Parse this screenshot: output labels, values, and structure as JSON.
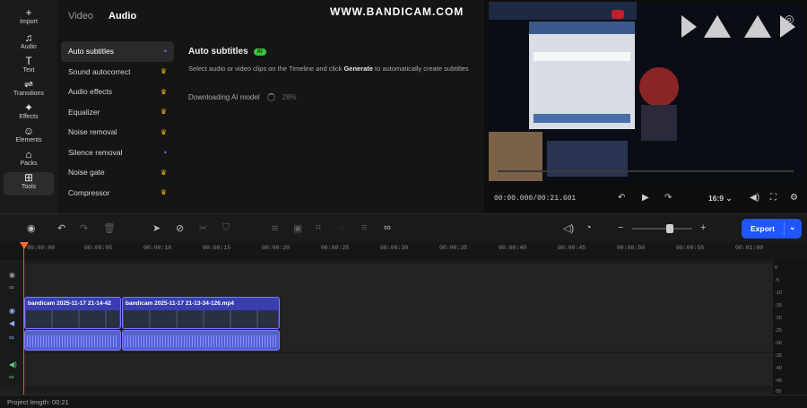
{
  "rail": [
    {
      "label": "Import",
      "icon": "plus-icon"
    },
    {
      "label": "Audio",
      "icon": "music-note-icon"
    },
    {
      "label": "Text",
      "icon": "text-icon"
    },
    {
      "label": "Transitions",
      "icon": "transitions-icon"
    },
    {
      "label": "Effects",
      "icon": "effects-icon"
    },
    {
      "label": "Elements",
      "icon": "elements-icon"
    },
    {
      "label": "Packs",
      "icon": "packs-icon"
    },
    {
      "label": "Tools",
      "icon": "tools-icon"
    }
  ],
  "tabs": {
    "video": "Video",
    "audio": "Audio"
  },
  "menu": [
    {
      "label": "Auto subtitles",
      "mark": "dot"
    },
    {
      "label": "Sound autocorrect",
      "mark": "crown"
    },
    {
      "label": "Audio effects",
      "mark": "crown"
    },
    {
      "label": "Equalizer",
      "mark": "crown"
    },
    {
      "label": "Noise removal",
      "mark": "crown"
    },
    {
      "label": "Silence removal",
      "mark": "dot"
    },
    {
      "label": "Noise gate",
      "mark": "crown"
    },
    {
      "label": "Compressor",
      "mark": "crown"
    }
  ],
  "panel": {
    "title": "Auto subtitles",
    "badge": "AI",
    "desc_part1": "Select audio or video clips on the Timeline and click ",
    "desc_bold": "Generate",
    "desc_part2": " to automatically create subtitles",
    "downloading": "Downloading AI model",
    "progress": "28%"
  },
  "preview": {
    "watermark": "WWW.BANDICAM.COM",
    "timecode": "00:00.000/00:21.601",
    "aspect": "16:9"
  },
  "toolbar": {
    "export": "Export"
  },
  "ruler": [
    "00:00:00",
    "00:00:05",
    "00:00:10",
    "00:00:15",
    "00:00:20",
    "00:00:25",
    "00:00:30",
    "00:00:35",
    "00:00:40",
    "00:00:45",
    "00:00:50",
    "00:00:55",
    "00:01:00"
  ],
  "clips": [
    {
      "name": "bandicam 2025-11-17 21-14-42"
    },
    {
      "name": "bandicam 2025-11-17 21-13-34-126.mp4"
    }
  ],
  "meter": [
    "0",
    "-5",
    "-10",
    "-15",
    "-20",
    "-25",
    "-30",
    "-35",
    "-40",
    "-45",
    "-50"
  ],
  "footer": {
    "project_length": "Project length: 00:21"
  },
  "colors": {
    "accent": "#2155ff",
    "playhead": "#ff4a2a",
    "clip": "#3a3fb0",
    "crown": "#f2b51c"
  }
}
